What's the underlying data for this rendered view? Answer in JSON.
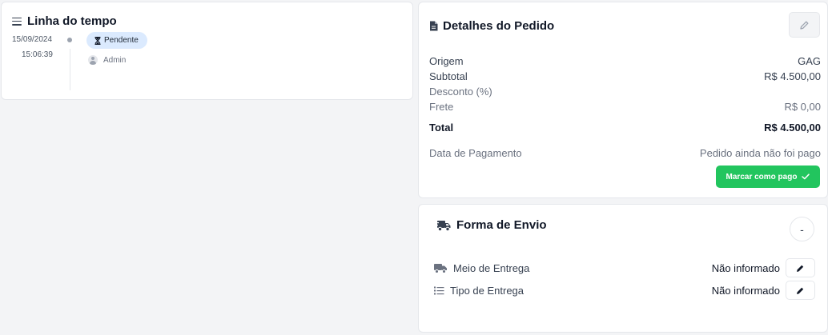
{
  "timeline": {
    "title": "Linha do tempo",
    "entries": [
      {
        "date": "15/09/2024",
        "time": "15:06:39",
        "status": "Pendente",
        "user": "Admin"
      }
    ]
  },
  "order_details": {
    "title": "Detalhes do Pedido",
    "rows": [
      {
        "label": "Origem",
        "value": "GAG"
      },
      {
        "label": "Subtotal",
        "value": "R$ 4.500,00"
      },
      {
        "label": "Desconto (%)",
        "value": ""
      },
      {
        "label": "Frete",
        "value": "R$ 0,00"
      },
      {
        "label": "Total",
        "value": "R$ 4.500,00"
      },
      {
        "label": "Data de Pagamento",
        "value": "Pedido ainda não foi pago"
      }
    ],
    "pay_button_label": "Marcar como pago"
  },
  "shipping": {
    "title": "Forma de Envio",
    "collapse_label": "-",
    "rows": [
      {
        "label": "Meio de Entrega",
        "value": "Não informado",
        "icon": "truck-icon"
      },
      {
        "label": "Tipo de Entrega",
        "value": "Não informado",
        "icon": "list-icon"
      }
    ]
  },
  "colors": {
    "accent_green": "#22c55e",
    "badge_blue": "#dbeafe",
    "background": "#f3f4f6"
  }
}
